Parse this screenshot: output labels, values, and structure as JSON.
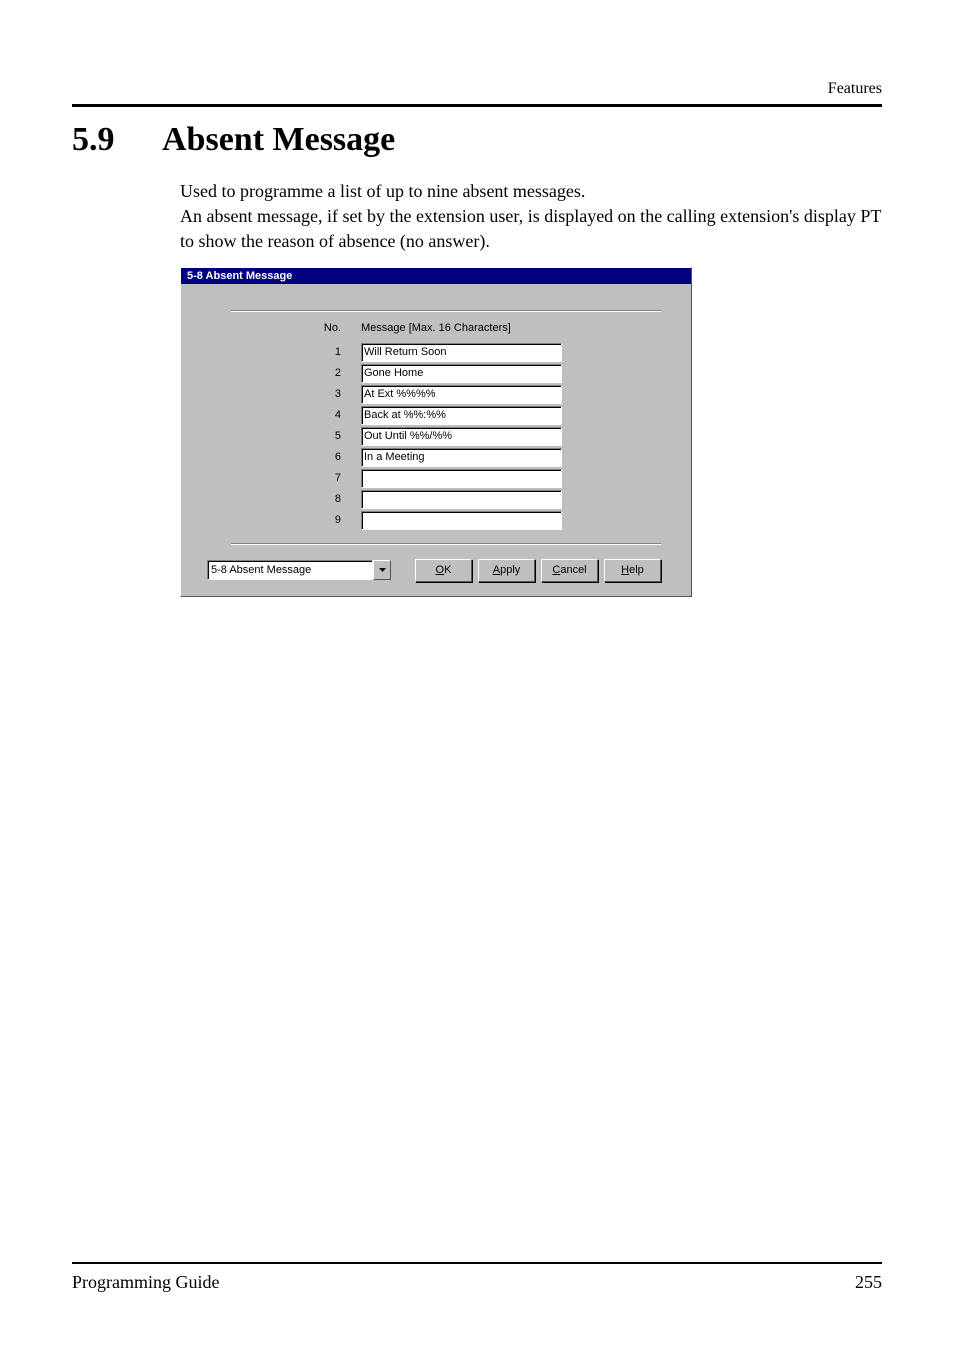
{
  "header": {
    "category": "Features"
  },
  "section": {
    "number": "5.9",
    "title": "Absent Message"
  },
  "paragraphs": {
    "p1": "Used to programme a list of up to nine absent messages.",
    "p2": "An absent message, if set by the extension user, is displayed on the calling extension's display PT to show the reason of absence (no answer)."
  },
  "window": {
    "title": "5-8 Absent Message",
    "columns": {
      "no": "No.",
      "message": "Message [Max. 16 Characters]"
    },
    "rows": [
      {
        "no": "1",
        "value": "Will Return Soon"
      },
      {
        "no": "2",
        "value": "Gone Home"
      },
      {
        "no": "3",
        "value": "At Ext %%%%"
      },
      {
        "no": "4",
        "value": "Back at %%:%%"
      },
      {
        "no": "5",
        "value": "Out Until %%/%%"
      },
      {
        "no": "6",
        "value": "In a Meeting"
      },
      {
        "no": "7",
        "value": ""
      },
      {
        "no": "8",
        "value": ""
      },
      {
        "no": "9",
        "value": ""
      }
    ],
    "combo_value": "5-8 Absent Message",
    "buttons": {
      "ok_u": "O",
      "ok_rest": "K",
      "apply_u": "A",
      "apply_rest": "pply",
      "cancel_u": "C",
      "cancel_rest": "ancel",
      "help_u": "H",
      "help_rest": "elp"
    }
  },
  "footer": {
    "left": "Programming Guide",
    "right": "255"
  }
}
